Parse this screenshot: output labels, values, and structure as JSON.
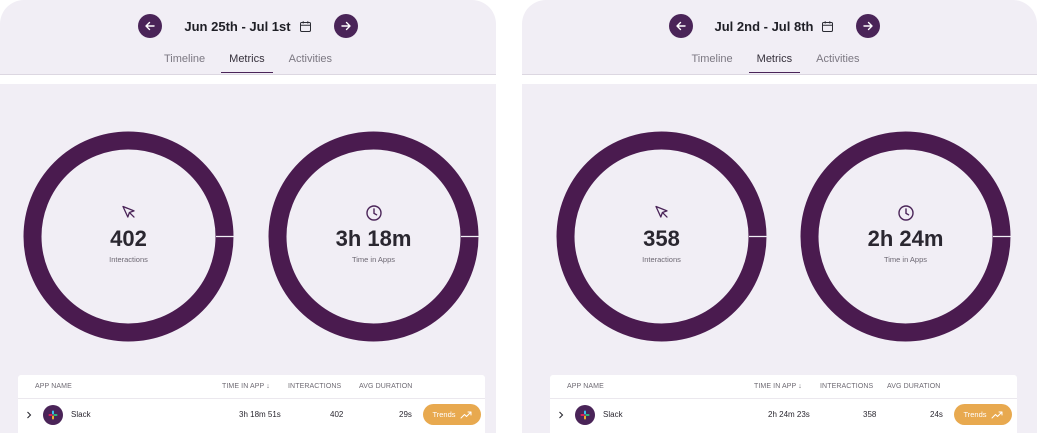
{
  "colors": {
    "accent": "#4a2458",
    "ring": "#4a1b4f",
    "trends": "#e8a94f",
    "panel_bg": "#f1eef5"
  },
  "panels": [
    {
      "date_range": "Jun 25th - Jul 1st",
      "tabs": [
        "Timeline",
        "Metrics",
        "Activities"
      ],
      "active_tab": "Metrics",
      "metrics": [
        {
          "icon": "cursor-icon",
          "value": "402",
          "label": "Interactions"
        },
        {
          "icon": "clock-icon",
          "value": "3h 18m",
          "label": "Time in Apps"
        }
      ],
      "table": {
        "headers": {
          "app_name": "APP NAME",
          "time_in_app": "TIME IN APP ↓",
          "interactions": "INTERACTIONS",
          "avg_duration": "AVG DURATION"
        },
        "rows": [
          {
            "app": "Slack",
            "time_in_app": "3h 18m 51s",
            "interactions": "402",
            "avg_duration": "29s",
            "action": "Trends"
          }
        ]
      }
    },
    {
      "date_range": "Jul 2nd - Jul 8th",
      "tabs": [
        "Timeline",
        "Metrics",
        "Activities"
      ],
      "active_tab": "Metrics",
      "metrics": [
        {
          "icon": "cursor-icon",
          "value": "358",
          "label": "Interactions"
        },
        {
          "icon": "clock-icon",
          "value": "2h 24m",
          "label": "Time in Apps"
        }
      ],
      "table": {
        "headers": {
          "app_name": "APP NAME",
          "time_in_app": "TIME IN APP ↓",
          "interactions": "INTERACTIONS",
          "avg_duration": "AVG DURATION"
        },
        "rows": [
          {
            "app": "Slack",
            "time_in_app": "2h 24m 23s",
            "interactions": "358",
            "avg_duration": "24s",
            "action": "Trends"
          }
        ]
      }
    }
  ]
}
